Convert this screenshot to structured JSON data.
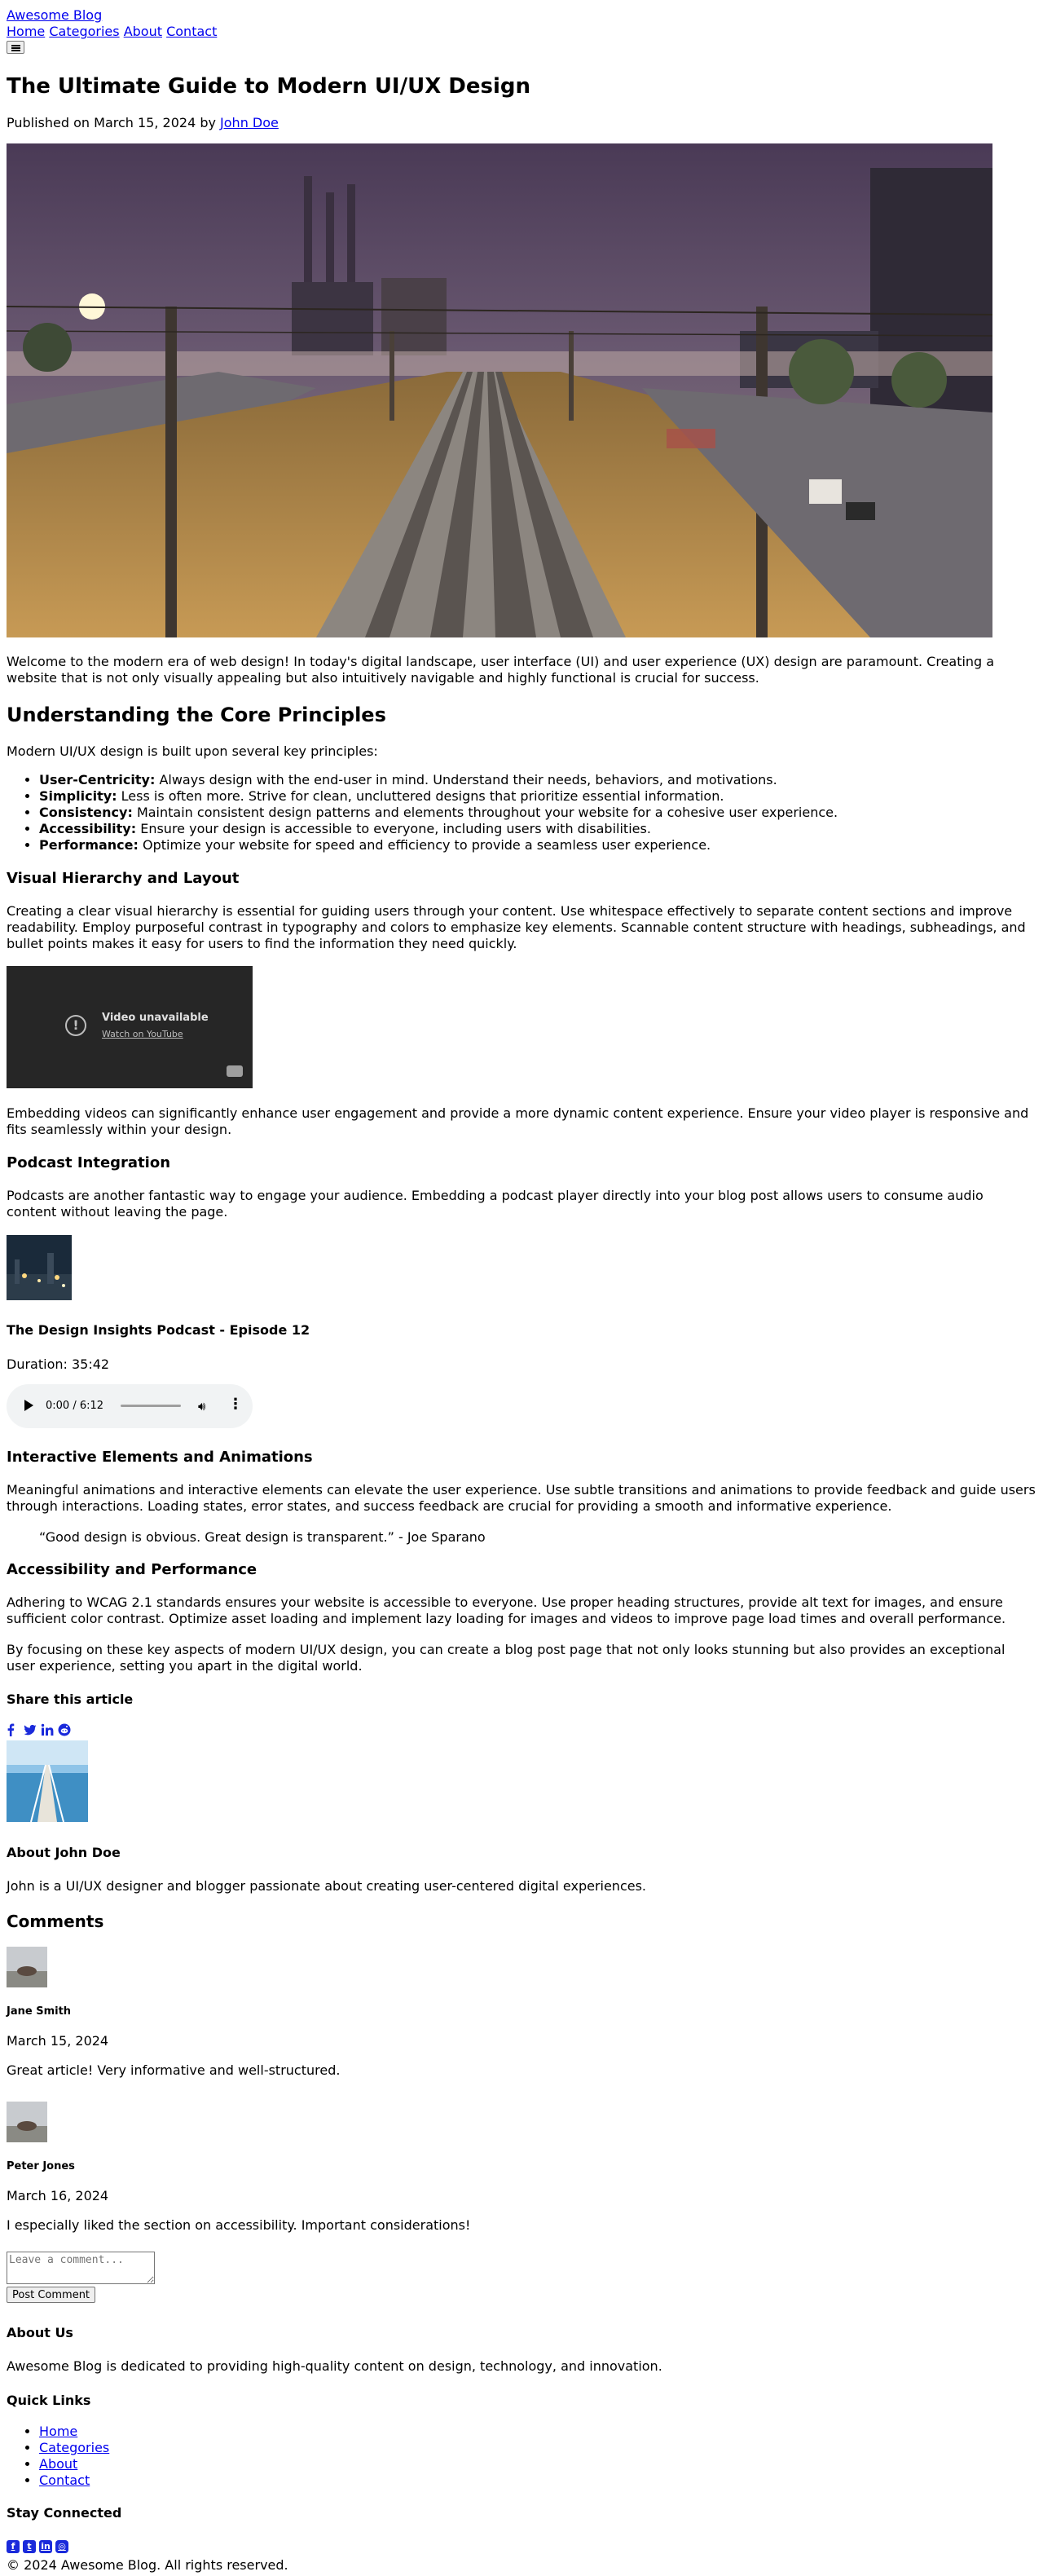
{
  "header": {
    "site_title": "Awesome Blog",
    "nav": [
      "Home",
      "Categories",
      "About",
      "Contact"
    ],
    "menu_button": "menu"
  },
  "article": {
    "title": "The Ultimate Guide to Modern UI/UX Design",
    "meta_prefix": "Published on March 15, 2024 by ",
    "author_link": "John Doe",
    "intro": "Welcome to the modern era of web design! In today's digital landscape, user interface (UI) and user experience (UX) design are paramount. Creating a website that is not only visually appealing but also intuitively navigable and highly functional is crucial for success.",
    "core": {
      "heading": "Understanding the Core Principles",
      "lead": "Modern UI/UX design is built upon several key principles:",
      "items": [
        {
          "term": "User-Centricity:",
          "text": " Always design with the end-user in mind. Understand their needs, behaviors, and motivations."
        },
        {
          "term": "Simplicity:",
          "text": " Less is often more. Strive for clean, uncluttered designs that prioritize essential information."
        },
        {
          "term": "Consistency:",
          "text": " Maintain consistent design patterns and elements throughout your website for a cohesive user experience."
        },
        {
          "term": "Accessibility:",
          "text": " Ensure your design is accessible to everyone, including users with disabilities."
        },
        {
          "term": "Performance:",
          "text": " Optimize your website for speed and efficiency to provide a seamless user experience."
        }
      ]
    },
    "hierarchy": {
      "heading": "Visual Hierarchy and Layout",
      "text": "Creating a clear visual hierarchy is essential for guiding users through your content. Use whitespace effectively to separate content sections and improve readability. Employ purposeful contrast in typography and colors to emphasize key elements. Scannable content structure with headings, subheadings, and bullet points makes it easy for users to find the information they need quickly."
    },
    "video": {
      "unavailable": "Video unavailable",
      "watch_link": "Watch on YouTube",
      "caption": "Embedding videos can significantly enhance user engagement and provide a more dynamic content experience. Ensure your video player is responsive and fits seamlessly within your design."
    },
    "podcast": {
      "heading": "Podcast Integration",
      "text": "Podcasts are another fantastic way to engage your audience. Embedding a podcast player directly into your blog post allows users to consume audio content without leaving the page.",
      "episode_title": "The Design Insights Podcast - Episode 12",
      "duration": "Duration: 35:42",
      "player_time": "0:00 / 6:12"
    },
    "interactive": {
      "heading": "Interactive Elements and Animations",
      "text": "Meaningful animations and interactive elements can elevate the user experience. Use subtle transitions and animations to provide feedback and guide users through interactions. Loading states, error states, and success feedback are crucial for providing a smooth and informative experience.",
      "quote": "“Good design is obvious. Great design is transparent.” - Joe Sparano"
    },
    "accessibility": {
      "heading": "Accessibility and Performance",
      "text": "Adhering to WCAG 2.1 standards ensures your website is accessible to everyone. Use proper heading structures, provide alt text for images, and ensure sufficient color contrast. Optimize asset loading and implement lazy loading for images and videos to improve page load times and overall performance.",
      "closing": "By focusing on these key aspects of modern UI/UX design, you can create a blog post page that not only looks stunning but also provides an exceptional user experience, setting you apart in the digital world."
    },
    "share": {
      "heading": "Share this article",
      "icons": [
        "facebook-icon",
        "twitter-icon",
        "linkedin-icon",
        "reddit-icon"
      ]
    },
    "author_box": {
      "heading": "About John Doe",
      "bio": "John is a UI/UX designer and blogger passionate about creating user-centered digital experiences."
    }
  },
  "comments": {
    "heading": "Comments",
    "items": [
      {
        "name": "Jane Smith",
        "date": "March 15, 2024",
        "text": "Great article! Very informative and well-structured."
      },
      {
        "name": "Peter Jones",
        "date": "March 16, 2024",
        "text": "I especially liked the section on accessibility. Important considerations!"
      }
    ],
    "placeholder": "Leave a comment...",
    "submit_label": "Post Comment"
  },
  "footer": {
    "about_heading": "About Us",
    "about_text": "Awesome Blog is dedicated to providing high-quality content on design, technology, and innovation.",
    "links_heading": "Quick Links",
    "links": [
      "Home",
      "Categories",
      "About",
      "Contact"
    ],
    "connect_heading": "Stay Connected",
    "social_icons": [
      "facebook-icon",
      "twitter-icon",
      "linkedin-icon",
      "instagram-icon"
    ],
    "copyright": "© 2024 Awesome Blog. All rights reserved."
  },
  "colors": {
    "link": "#0000ee",
    "icon_blue": "#1a2adb",
    "video_bg": "#262626",
    "audio_bg": "#f1f3f4"
  }
}
